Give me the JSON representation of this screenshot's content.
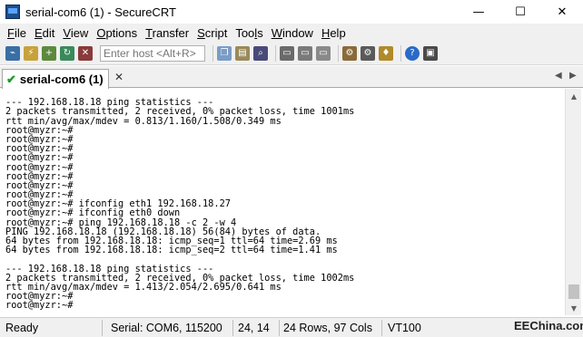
{
  "window": {
    "title": "serial-com6 (1) - SecureCRT",
    "minimize_glyph": "—",
    "maximize_glyph": "☐",
    "close_glyph": "✕"
  },
  "menu": {
    "items": [
      {
        "label": "File",
        "u": "F",
        "rest": "ile"
      },
      {
        "label": "Edit",
        "u": "E",
        "rest": "dit"
      },
      {
        "label": "View",
        "u": "V",
        "rest": "iew"
      },
      {
        "label": "Options",
        "u": "O",
        "rest": "ptions"
      },
      {
        "label": "Transfer",
        "u": "T",
        "rest": "ransfer"
      },
      {
        "label": "Script",
        "u": "S",
        "rest": "cript"
      },
      {
        "label": "Tools",
        "pre": "Too",
        "u": "l",
        "rest": "s"
      },
      {
        "label": "Window",
        "u": "W",
        "rest": "indow"
      },
      {
        "label": "Help",
        "u": "H",
        "rest": "elp"
      }
    ]
  },
  "toolbar": {
    "host_placeholder": "Enter host <Alt+R>",
    "icons": [
      "connect-icon",
      "quick-connect-icon",
      "connect-tab-icon",
      "reconnect-icon",
      "disconnect-icon",
      "copy-icon",
      "paste-icon",
      "find-icon",
      "print-icon",
      "print-setup-icon",
      "print-selection-icon",
      "session-options-icon",
      "global-options-icon",
      "keymap-icon",
      "help-icon",
      "about-icon"
    ]
  },
  "tab": {
    "label": "serial-com6 (1)",
    "close_glyph": "✕",
    "prev_glyph": "◀",
    "next_glyph": "▶"
  },
  "terminal": {
    "lines": [
      "",
      "--- 192.168.18.18 ping statistics ---",
      "2 packets transmitted, 2 received, 0% packet loss, time 1001ms",
      "rtt min/avg/max/mdev = 0.813/1.160/1.508/0.349 ms",
      "root@myzr:~#",
      "root@myzr:~#",
      "root@myzr:~#",
      "root@myzr:~#",
      "root@myzr:~#",
      "root@myzr:~#",
      "root@myzr:~#",
      "root@myzr:~#",
      "root@myzr:~# ifconfig eth1 192.168.18.27",
      "root@myzr:~# ifconfig eth0 down",
      "root@myzr:~# ping 192.168.18.18 -c 2 -w 4",
      "PING 192.168.18.18 (192.168.18.18) 56(84) bytes of data.",
      "64 bytes from 192.168.18.18: icmp_seq=1 ttl=64 time=2.69 ms",
      "64 bytes from 192.168.18.18: icmp_seq=2 ttl=64 time=1.41 ms",
      "",
      "--- 192.168.18.18 ping statistics ---",
      "2 packets transmitted, 2 received, 0% packet loss, time 1002ms",
      "rtt min/avg/max/mdev = 1.413/2.054/2.695/0.641 ms",
      "root@myzr:~#",
      "root@myzr:~#"
    ]
  },
  "status": {
    "ready": "Ready",
    "serial": "Serial: COM6, 115200",
    "cursor": "24,  14",
    "size": "24 Rows, 97 Cols",
    "emulation": "VT100",
    "watermark": "EEChina.com"
  },
  "colors": {
    "check": "#1c9b2d",
    "app_icon": "#1f4e8c"
  }
}
